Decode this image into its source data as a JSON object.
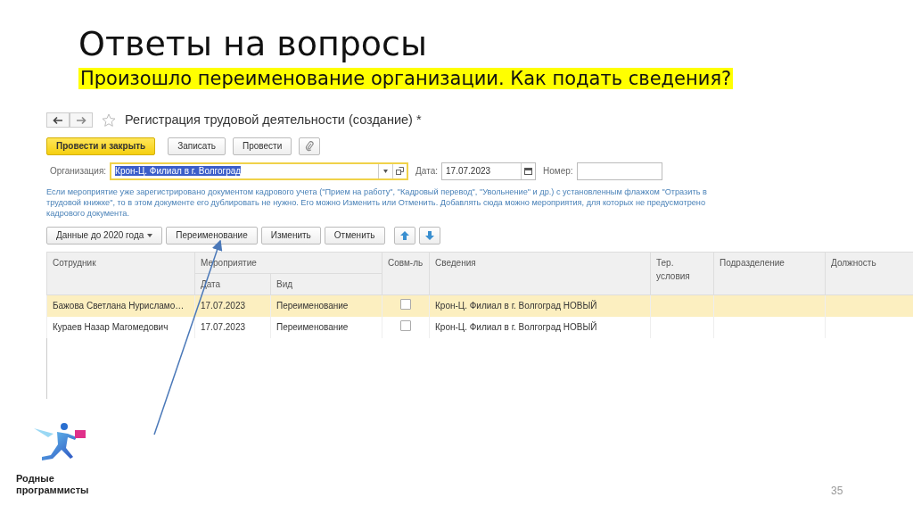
{
  "slide": {
    "title": "Ответы на вопросы",
    "subtitle": "Произошло переименование организации. Как подать сведения?",
    "page_number": "35",
    "logo_text": [
      "Родные",
      "программисты"
    ]
  },
  "window": {
    "title": "Регистрация трудовой деятельности (создание) *"
  },
  "toolbar": [
    {
      "kind": "primary",
      "label": "Провести и закрыть"
    },
    {
      "kind": "default",
      "label": "Записать"
    },
    {
      "kind": "default",
      "label": "Провести"
    },
    {
      "kind": "attach"
    }
  ],
  "fields": [
    {
      "kind": "organization",
      "label": "Организация:",
      "value": "Крон-Ц. Филиал в г. Волгоград",
      "focused": true
    },
    {
      "kind": "date",
      "label": "Дата:",
      "value": "17.07.2023"
    },
    {
      "kind": "text",
      "label": "Номер:"
    }
  ],
  "hint": "Если мероприятие уже зарегистрировано документом кадрового учета (\"Прием на работу\", \"Кадровый перевод\", \"Увольнение\" и др.) с установленным флажком \"Отразить в трудовой книжке\", то в этом документе его дублировать не нужно. Его можно Изменить или Отменить. Добавлять сюда можно мероприятия, для которых не предусмотрено кадрового документа.",
  "table_toolbar": [
    {
      "kind": "dropdown",
      "label": "Данные до 2020 года"
    },
    {
      "kind": "default",
      "label": "Переименование"
    },
    {
      "kind": "default",
      "label": "Изменить"
    },
    {
      "kind": "default",
      "label": "Отменить"
    },
    {
      "kind": "up"
    },
    {
      "kind": "down"
    }
  ],
  "table": {
    "columns": [
      {
        "label": "Сотрудник"
      },
      {
        "label": "Мероприятие",
        "children": [
          {
            "label": "Дата"
          },
          {
            "label": "Вид"
          }
        ]
      },
      {
        "label": "Совм-ль"
      },
      {
        "label": "Сведения"
      },
      {
        "label": "Тер. условия"
      },
      {
        "label": "Подразделение"
      },
      {
        "label": "Должность"
      }
    ],
    "rows": [
      {
        "selected": true,
        "employee": "Бажова Светлана Нурисламо…",
        "date": "17.07.2023",
        "type": "Переименование",
        "combined": false,
        "info": "Крон-Ц. Филиал в г. Волгоград НОВЫЙ"
      },
      {
        "selected": false,
        "employee": "Кураев Назар Магомедович",
        "date": "17.07.2023",
        "type": "Переименование",
        "combined": false,
        "info": "Крон-Ц. Филиал в г. Волгоград НОВЫЙ"
      }
    ]
  }
}
